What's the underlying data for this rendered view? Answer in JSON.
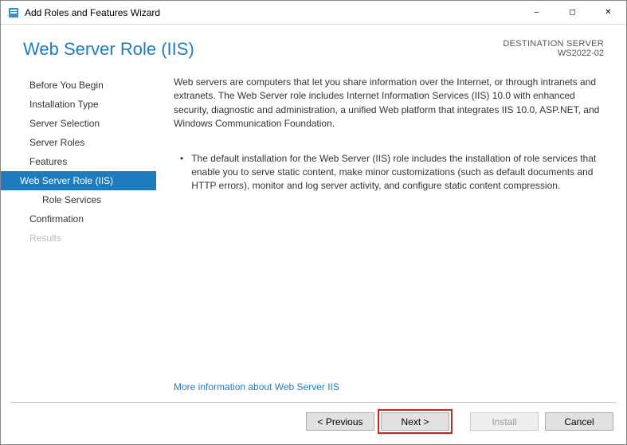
{
  "window": {
    "title": "Add Roles and Features Wizard"
  },
  "header": {
    "page_title": "Web Server Role (IIS)",
    "destination_label": "DESTINATION SERVER",
    "destination_value": "WS2022-02"
  },
  "sidebar": {
    "steps": [
      {
        "label": "Before You Begin",
        "selected": false,
        "disabled": false,
        "sub": false
      },
      {
        "label": "Installation Type",
        "selected": false,
        "disabled": false,
        "sub": false
      },
      {
        "label": "Server Selection",
        "selected": false,
        "disabled": false,
        "sub": false
      },
      {
        "label": "Server Roles",
        "selected": false,
        "disabled": false,
        "sub": false
      },
      {
        "label": "Features",
        "selected": false,
        "disabled": false,
        "sub": false
      },
      {
        "label": "Web Server Role (IIS)",
        "selected": true,
        "disabled": false,
        "sub": false
      },
      {
        "label": "Role Services",
        "selected": false,
        "disabled": false,
        "sub": true
      },
      {
        "label": "Confirmation",
        "selected": false,
        "disabled": false,
        "sub": false
      },
      {
        "label": "Results",
        "selected": false,
        "disabled": true,
        "sub": false
      }
    ]
  },
  "content": {
    "intro": "Web servers are computers that let you share information over the Internet, or through intranets and extranets. The Web Server role includes Internet Information Services (IIS) 10.0 with enhanced security, diagnostic and administration, a unified Web platform that integrates IIS 10.0, ASP.NET, and Windows Communication Foundation.",
    "bullets": [
      "The default installation for the Web Server (IIS) role includes the installation of role services that enable you to serve static content, make minor customizations (such as default documents and HTTP errors), monitor and log server activity, and configure static content compression."
    ],
    "more_link": "More information about Web Server IIS"
  },
  "footer": {
    "previous": "< Previous",
    "next": "Next >",
    "install": "Install",
    "cancel": "Cancel"
  }
}
